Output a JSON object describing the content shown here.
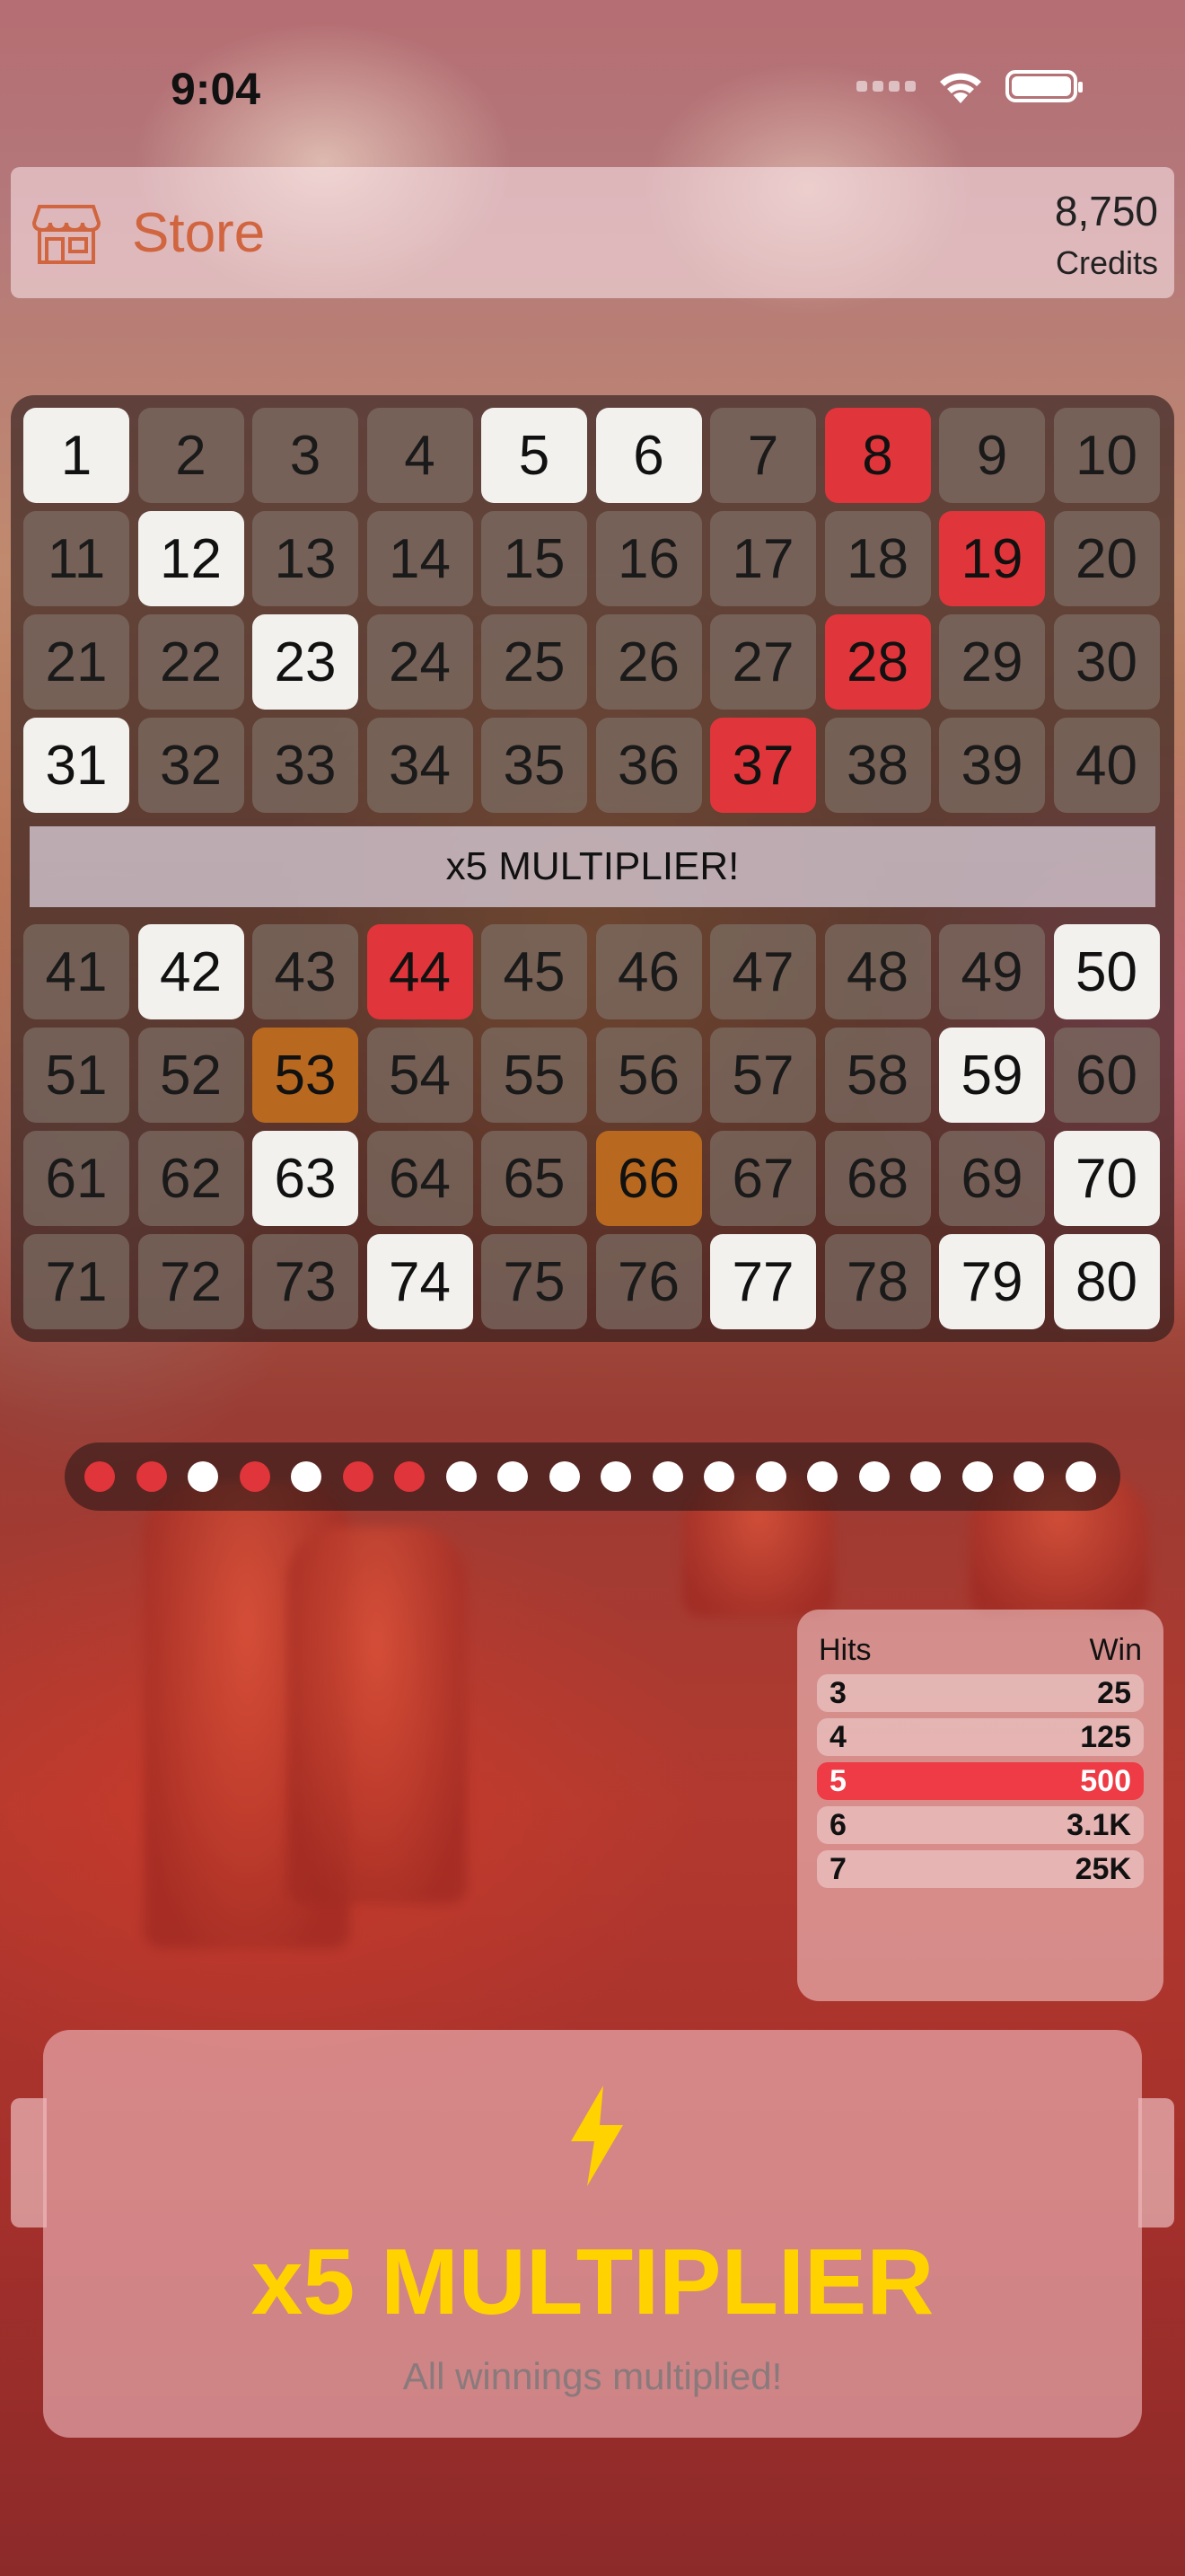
{
  "status_bar": {
    "time": "9:04"
  },
  "header": {
    "store_label": "Store",
    "credits_value": "8,750",
    "credits_label": "Credits"
  },
  "board": {
    "banner": "x5 MULTIPLIER!",
    "top_rows": [
      [
        {
          "n": "1",
          "s": "sel"
        },
        {
          "n": "2",
          "s": ""
        },
        {
          "n": "3",
          "s": ""
        },
        {
          "n": "4",
          "s": ""
        },
        {
          "n": "5",
          "s": "sel"
        },
        {
          "n": "6",
          "s": "sel"
        },
        {
          "n": "7",
          "s": ""
        },
        {
          "n": "8",
          "s": "hit"
        },
        {
          "n": "9",
          "s": ""
        },
        {
          "n": "10",
          "s": ""
        }
      ],
      [
        {
          "n": "11",
          "s": ""
        },
        {
          "n": "12",
          "s": "sel"
        },
        {
          "n": "13",
          "s": ""
        },
        {
          "n": "14",
          "s": ""
        },
        {
          "n": "15",
          "s": ""
        },
        {
          "n": "16",
          "s": ""
        },
        {
          "n": "17",
          "s": ""
        },
        {
          "n": "18",
          "s": ""
        },
        {
          "n": "19",
          "s": "hit"
        },
        {
          "n": "20",
          "s": ""
        }
      ],
      [
        {
          "n": "21",
          "s": ""
        },
        {
          "n": "22",
          "s": ""
        },
        {
          "n": "23",
          "s": "sel"
        },
        {
          "n": "24",
          "s": ""
        },
        {
          "n": "25",
          "s": ""
        },
        {
          "n": "26",
          "s": ""
        },
        {
          "n": "27",
          "s": ""
        },
        {
          "n": "28",
          "s": "hit"
        },
        {
          "n": "29",
          "s": ""
        },
        {
          "n": "30",
          "s": ""
        }
      ],
      [
        {
          "n": "31",
          "s": "sel"
        },
        {
          "n": "32",
          "s": ""
        },
        {
          "n": "33",
          "s": ""
        },
        {
          "n": "34",
          "s": ""
        },
        {
          "n": "35",
          "s": ""
        },
        {
          "n": "36",
          "s": ""
        },
        {
          "n": "37",
          "s": "hit"
        },
        {
          "n": "38",
          "s": ""
        },
        {
          "n": "39",
          "s": ""
        },
        {
          "n": "40",
          "s": ""
        }
      ]
    ],
    "bottom_rows": [
      [
        {
          "n": "41",
          "s": ""
        },
        {
          "n": "42",
          "s": "sel"
        },
        {
          "n": "43",
          "s": ""
        },
        {
          "n": "44",
          "s": "hit"
        },
        {
          "n": "45",
          "s": ""
        },
        {
          "n": "46",
          "s": ""
        },
        {
          "n": "47",
          "s": ""
        },
        {
          "n": "48",
          "s": ""
        },
        {
          "n": "49",
          "s": ""
        },
        {
          "n": "50",
          "s": "sel"
        }
      ],
      [
        {
          "n": "51",
          "s": ""
        },
        {
          "n": "52",
          "s": ""
        },
        {
          "n": "53",
          "s": "bonus"
        },
        {
          "n": "54",
          "s": ""
        },
        {
          "n": "55",
          "s": ""
        },
        {
          "n": "56",
          "s": ""
        },
        {
          "n": "57",
          "s": ""
        },
        {
          "n": "58",
          "s": ""
        },
        {
          "n": "59",
          "s": "sel"
        },
        {
          "n": "60",
          "s": ""
        }
      ],
      [
        {
          "n": "61",
          "s": ""
        },
        {
          "n": "62",
          "s": ""
        },
        {
          "n": "63",
          "s": "sel"
        },
        {
          "n": "64",
          "s": ""
        },
        {
          "n": "65",
          "s": ""
        },
        {
          "n": "66",
          "s": "bonus"
        },
        {
          "n": "67",
          "s": ""
        },
        {
          "n": "68",
          "s": ""
        },
        {
          "n": "69",
          "s": ""
        },
        {
          "n": "70",
          "s": "sel"
        }
      ],
      [
        {
          "n": "71",
          "s": ""
        },
        {
          "n": "72",
          "s": ""
        },
        {
          "n": "73",
          "s": ""
        },
        {
          "n": "74",
          "s": "sel"
        },
        {
          "n": "75",
          "s": ""
        },
        {
          "n": "76",
          "s": ""
        },
        {
          "n": "77",
          "s": "sel"
        },
        {
          "n": "78",
          "s": ""
        },
        {
          "n": "79",
          "s": "sel"
        },
        {
          "n": "80",
          "s": "sel"
        }
      ]
    ]
  },
  "draw_progress": [
    "red",
    "red",
    "white",
    "red",
    "white",
    "red",
    "red",
    "white",
    "white",
    "white",
    "white",
    "white",
    "white",
    "white",
    "white",
    "white",
    "white",
    "white",
    "white",
    "white"
  ],
  "paytable": {
    "hits_header": "Hits",
    "win_header": "Win",
    "rows": [
      {
        "hits": "3",
        "win": "25",
        "active": false
      },
      {
        "hits": "4",
        "win": "125",
        "active": false
      },
      {
        "hits": "5",
        "win": "500",
        "active": true
      },
      {
        "hits": "6",
        "win": "3.1K",
        "active": false
      },
      {
        "hits": "7",
        "win": "25K",
        "active": false
      }
    ]
  },
  "multiplier": {
    "icon": "lightning-bolt-icon",
    "title": "x5 MULTIPLIER",
    "subtitle": "All winnings multiplied!"
  },
  "colors": {
    "hit": "#e0353a",
    "selected": "#f2f1ee",
    "bonus": "#b8691f",
    "store_accent": "#d0653f",
    "multiplier_gold": "#ffd200"
  }
}
